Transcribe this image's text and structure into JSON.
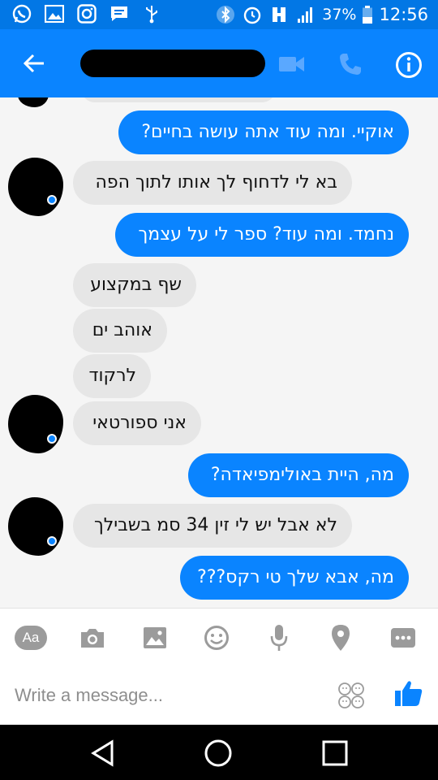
{
  "status_bar": {
    "battery": "37%",
    "time": "12:56",
    "left_icons": [
      "whatsapp-icon",
      "gallery-icon",
      "instagram-icon",
      "message-icon",
      "usb-icon"
    ],
    "right_icons": [
      "bluetooth-icon",
      "alarm-icon",
      "sim-icon",
      "signal-icon",
      "battery-icon"
    ]
  },
  "header": {
    "title": "",
    "icons": [
      "back-arrow-icon",
      "video-call-icon",
      "phone-call-icon",
      "info-icon"
    ]
  },
  "messages": [
    {
      "from": "me",
      "text": "אוקיי. ומה עוד אתה עושה בחיים?"
    },
    {
      "from": "them",
      "text": "בא לי לדחוף לך אותו לתוך הפה"
    },
    {
      "from": "me",
      "text": "נחמד. ומה עוד? ספר לי על עצמך"
    },
    {
      "from": "them",
      "text": "שף במקצוע"
    },
    {
      "from": "them",
      "text": "אוהב ים"
    },
    {
      "from": "them",
      "text": "לרקוד"
    },
    {
      "from": "them",
      "text": "אני ספורטאי"
    },
    {
      "from": "me",
      "text": "מה, היית באולימפיאדה?"
    },
    {
      "from": "them",
      "text": "לא אבל יש לי זין 34 סמ בשבילך"
    },
    {
      "from": "me",
      "text": "מה, אבא שלך טי רקס???"
    }
  ],
  "composer": {
    "aa_label": "Aa",
    "placeholder": "Write a message...",
    "tools": [
      "text-style-button",
      "camera-icon",
      "photo-icon",
      "emoji-icon",
      "microphone-icon",
      "location-icon",
      "more-icon"
    ]
  },
  "colors": {
    "accent": "#0a84ff",
    "status_bar": "#0277e5",
    "incoming_bubble": "#e6e6e6",
    "background": "#f5f5f5"
  }
}
